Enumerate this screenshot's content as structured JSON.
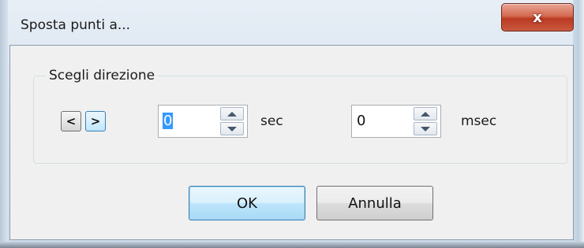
{
  "window": {
    "title": "Sposta punti a...",
    "close_glyph": "x"
  },
  "group": {
    "label": "Scegli direzione"
  },
  "direction": {
    "left_glyph": "<",
    "right_glyph": ">",
    "selected": "right"
  },
  "seconds": {
    "value": "0",
    "unit": "sec"
  },
  "milliseconds": {
    "value": "0",
    "unit": "msec"
  },
  "buttons": {
    "ok": "OK",
    "cancel": "Annulla"
  },
  "icons": {
    "close": "close-icon",
    "spin_up": "spin-up-icon",
    "spin_down": "spin-down-icon"
  }
}
